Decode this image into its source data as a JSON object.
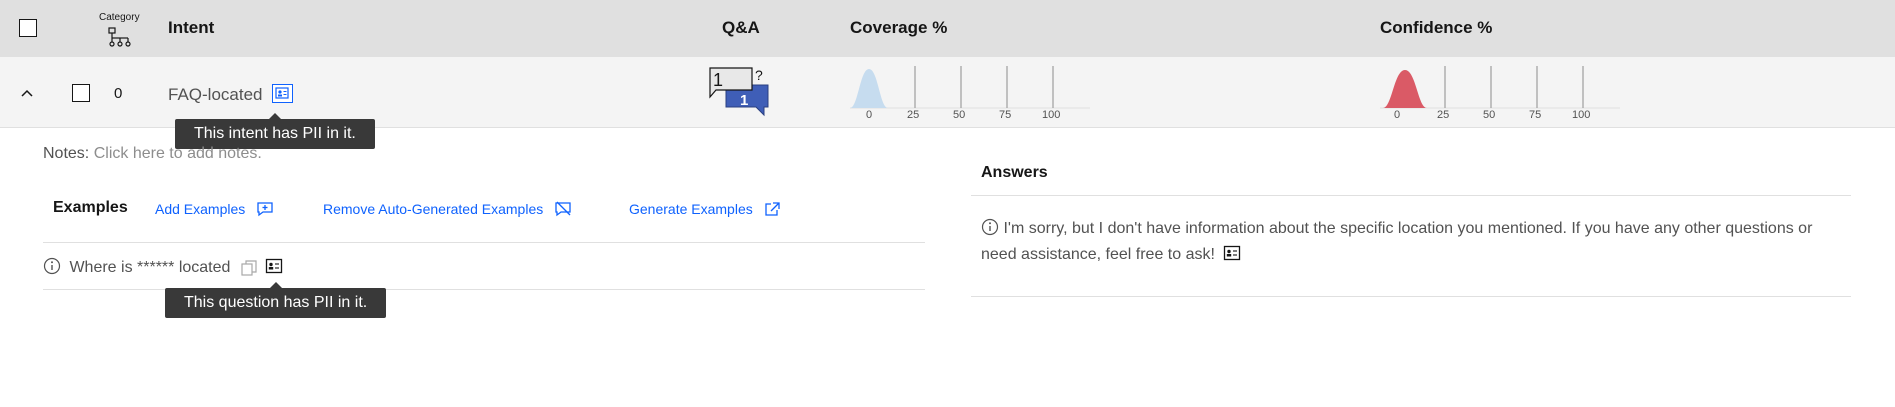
{
  "header": {
    "category_label": "Category",
    "intent_label": "Intent",
    "qa_label": "Q&A",
    "coverage_label": "Coverage %",
    "confidence_label": "Confidence %"
  },
  "row": {
    "count": "0",
    "intent_name": "FAQ-located",
    "intent_pii_tooltip": "This intent has PII in it.",
    "qa_question_count": "1",
    "qa_answer_count": "1",
    "coverage_ticks": [
      "0",
      "25",
      "50",
      "75",
      "100"
    ],
    "confidence_ticks": [
      "0",
      "25",
      "50",
      "75",
      "100"
    ],
    "colors": {
      "coverage": "#c6dcef",
      "confidence": "#da5a66",
      "accent": "#0f62fe"
    }
  },
  "notes": {
    "label": "Notes:",
    "placeholder": "Click here to add notes."
  },
  "examples": {
    "title": "Examples",
    "add_label": "Add Examples",
    "remove_label": "Remove Auto-Generated Examples",
    "generate_label": "Generate Examples",
    "items": [
      {
        "text": "Where is ****** located",
        "pii_tooltip": "This question has PII in it."
      }
    ]
  },
  "answers": {
    "title": "Answers",
    "text": "I'm sorry, but I don't have information about the specific location you mentioned. If you have any other questions or need assistance, feel free to ask!"
  }
}
